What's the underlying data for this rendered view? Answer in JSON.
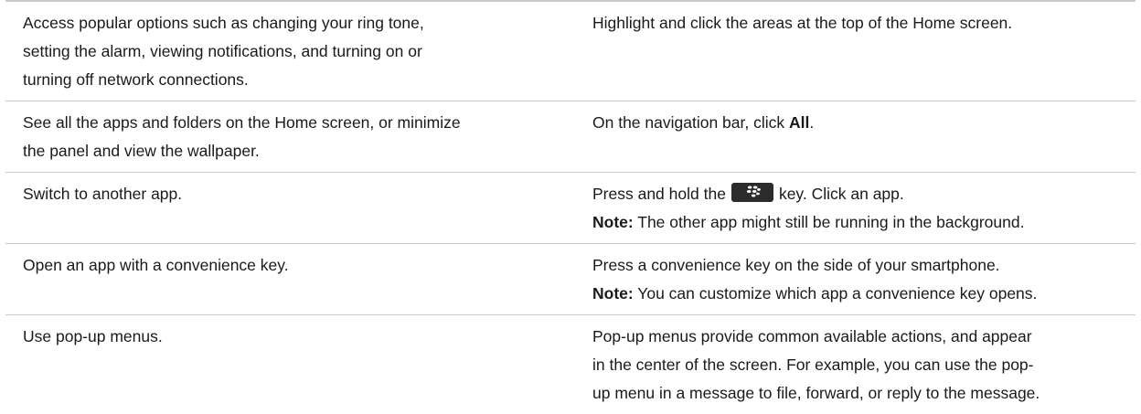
{
  "rows": [
    {
      "task_lines": [
        "Access popular options such as changing your ring tone,",
        "setting the alarm, viewing notifications, and turning on or",
        "turning off network connections."
      ],
      "action": "Highlight and click the areas at the top of the Home screen."
    },
    {
      "task_lines": [
        "See all the apps and folders on the Home screen, or minimize",
        "the panel and view the wallpaper."
      ],
      "action_prefix": "On the navigation bar, click ",
      "action_bold": "All",
      "action_suffix": "."
    },
    {
      "task": "Switch to another app.",
      "action_before_key": "Press and hold the",
      "key_icon": "blackberry-menu-key-icon",
      "action_after_key": "key. Click an app.",
      "note_label": "Note:",
      "note_text": " The other app might still be running in the background."
    },
    {
      "task": "Open an app with a convenience key.",
      "action": "Press a convenience key on the side of your smartphone.",
      "note_label": "Note:",
      "note_text": " You can customize which app a convenience key opens."
    },
    {
      "task": "Use pop-up menus.",
      "action_lines": [
        "Pop-up menus provide common available actions, and appear",
        "in the center of the screen. For example, you can use the pop-",
        "up menu in a message to file, forward, or reply to the message."
      ]
    }
  ],
  "colors": {
    "text": "#1a1a1a",
    "rule": "#c9c9c9",
    "key_background": "#2b2b2b",
    "key_glyph": "#ffffff"
  }
}
